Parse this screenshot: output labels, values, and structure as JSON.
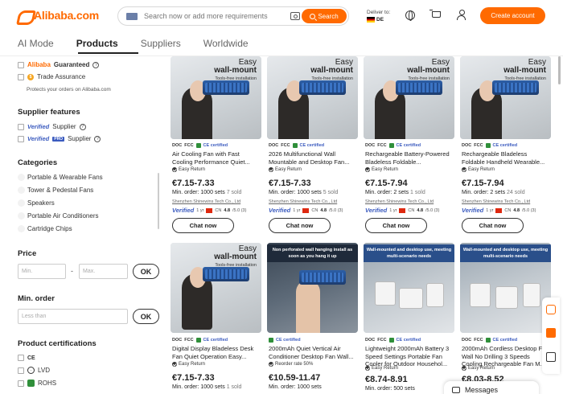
{
  "header": {
    "logo": "Alibaba.com",
    "search_placeholder": "Search now or add more requirements",
    "search_button": "Search",
    "deliver_to": "Deliver to:",
    "country": "DE",
    "create_account": "Create account"
  },
  "tabs": [
    {
      "label": "AI Mode",
      "active": false
    },
    {
      "label": "Products",
      "active": true
    },
    {
      "label": "Suppliers",
      "active": false
    },
    {
      "label": "Worldwide",
      "active": false
    }
  ],
  "sidebar": {
    "guaranteed_brand": "Alibaba",
    "guaranteed_word": "Guaranteed",
    "trade_assurance": "Trade Assurance",
    "trade_note": "Protects your orders on Alibaba.com",
    "supplier_features_title": "Supplier features",
    "verified_word": "Verified",
    "verified_supplier": "Supplier",
    "pro_badge": "PRO",
    "verified_pro_supplier": "Supplier",
    "categories_title": "Categories",
    "categories": [
      "Portable & Wearable Fans",
      "Tower & Pedestal Fans",
      "Speakers",
      "Portable Air Conditioners",
      "Cartridge Chips"
    ],
    "price_title": "Price",
    "price_min_placeholder": "Min.",
    "price_max_placeholder": "Max.",
    "range_dash": "-",
    "ok_label": "OK",
    "min_order_title": "Min. order",
    "min_order_placeholder": "Less than",
    "certs_title": "Product certifications",
    "certs": [
      "CE",
      "LVD",
      "ROHS"
    ]
  },
  "products": [
    {
      "image_caption": [
        "Easy",
        "wall-mount",
        "Tools-free installation"
      ],
      "badges": [
        "DOC",
        "FCC",
        "CE certified"
      ],
      "title": "Air Cooling Fan with Fast Cooling Performance Quiet...",
      "tag": "Easy Return",
      "price": "€7.15-7.33",
      "moq": "Min. order: 1000 sets",
      "sold": "7 sold",
      "supplier": "Shenzhen Shinewins Tech Co., Ltd",
      "verified": "Verified",
      "years": "1 yr",
      "country": "CN",
      "rating": "4.8",
      "rating_of": "/5.0 (3)",
      "chat": "Chat now"
    },
    {
      "image_caption": [
        "Easy",
        "wall-mount",
        "Tools-free installation"
      ],
      "badges": [
        "DOC",
        "FCC",
        "CE certified"
      ],
      "title": "2026 Multifunctional Wall Mountable and Desktop Fan...",
      "tag": "Easy Return",
      "price": "€7.15-7.33",
      "moq": "Min. order: 1000 sets",
      "sold": "5 sold",
      "supplier": "Shenzhen Shinewins Tech Co., Ltd",
      "verified": "Verified",
      "years": "1 yr",
      "country": "CN",
      "rating": "4.8",
      "rating_of": "/5.0 (3)",
      "chat": "Chat now"
    },
    {
      "image_caption": [
        "Easy",
        "wall-mount",
        "Tools-free installation"
      ],
      "badges": [
        "DOC",
        "FCC",
        "CE certified"
      ],
      "title": "Rechargeable Battery-Powered Bladeless Foldable...",
      "tag": "Easy Return",
      "price": "€7.15-7.94",
      "moq": "Min. order: 2 sets",
      "sold": "1 sold",
      "supplier": "Shenzhen Shinewins Tech Co., Ltd",
      "verified": "Verified",
      "years": "1 yr",
      "country": "CN",
      "rating": "4.8",
      "rating_of": "/5.0 (3)",
      "chat": "Chat now"
    },
    {
      "image_caption": [
        "Easy",
        "wall-mount",
        "Tools-free installation"
      ],
      "badges": [
        "DOC",
        "FCC",
        "CE certified"
      ],
      "title": "Rechargeable Bladeless Foldable Handheld Wearable...",
      "tag": "Easy Return",
      "price": "€7.15-7.94",
      "moq": "Min. order: 2 sets",
      "sold": "24 sold",
      "supplier": "Shenzhen Shinewins Tech Co., Ltd",
      "verified": "Verified",
      "years": "1 yr",
      "country": "CN",
      "rating": "4.8",
      "rating_of": "/5.0 (3)",
      "chat": "Chat now"
    },
    {
      "image_caption": [
        "Easy",
        "wall-mount",
        "Tools-free installation"
      ],
      "badges": [
        "DOC",
        "FCC",
        "CE certified"
      ],
      "title": "Digital Display Bladeless Desk Fan Quiet Operation Easy...",
      "tag": "Easy Return",
      "price": "€7.15-7.33",
      "moq": "Min. order: 1000 sets",
      "sold": "1 sold"
    },
    {
      "image_banner": "Non perforated wall hanging install as soon as you hang it up",
      "badges": [
        "CE certified"
      ],
      "title": "2000mAh Quiet Vertical Air Conditioner Desktop Fan Wall...",
      "tag": "Reorder rate 50%",
      "price": "€10.59-11.47",
      "moq": "Min. order: 1000 sets",
      "sold": ""
    },
    {
      "image_banner": "Wall-mounted and desktop use, meeting multi-scenario needs",
      "badges": [
        "DOC",
        "FCC",
        "CE certified"
      ],
      "title": "Lightweight 2000mAh Battery 3 Speed Settings Portable Fan Cooler for Outdoor Househol...",
      "tag": "Easy Return",
      "price": "€8.74-8.91",
      "moq": "Min. order: 500 sets",
      "sold": ""
    },
    {
      "image_banner": "Wall-mounted and desktop use, meeting multi-scenario needs",
      "badges": [
        "DOC",
        "FCC",
        "CE certified"
      ],
      "title": "2000mAh Cordless Desktop Fan Wall No Drilling 3 Speeds Cooling Rechargeable Fan M...",
      "tag": "Easy Return",
      "price": "€8.03-8.52",
      "moq": "",
      "sold": ""
    }
  ],
  "messages": {
    "label": "Messages"
  }
}
